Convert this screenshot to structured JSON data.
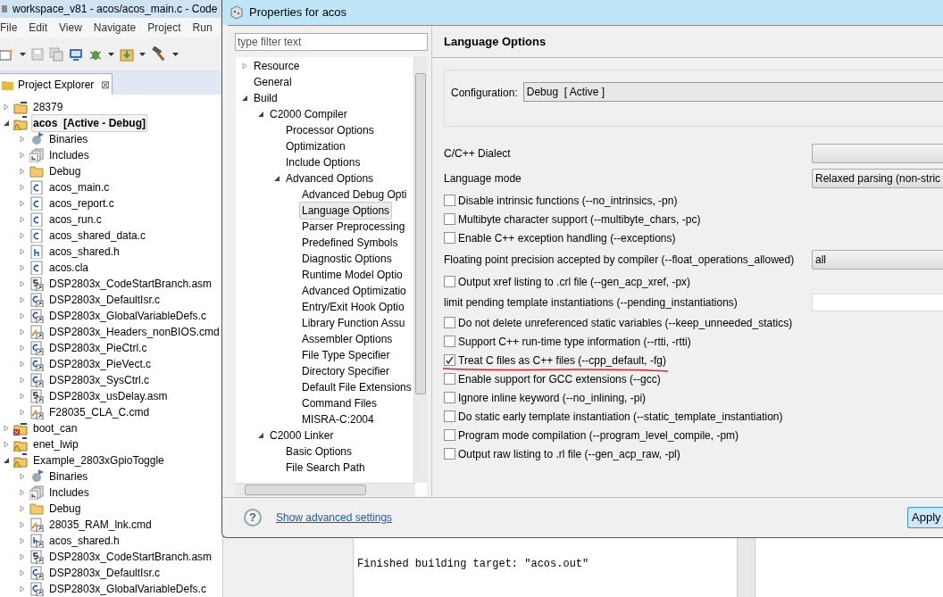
{
  "ide": {
    "title": "workspace_v81 - acos/acos_main.c - Code",
    "menu": [
      "File",
      "Edit",
      "View",
      "Navigate",
      "Project",
      "Run"
    ],
    "explorer": {
      "tab": "Project Explorer",
      "close": "⊠",
      "projects": [
        {
          "label": "28379",
          "kind": "project",
          "selected": false,
          "bold": false,
          "expanded": false
        },
        {
          "label": "acos  [Active - Debug]",
          "kind": "project-warning",
          "selected": true,
          "bold": true,
          "expanded": true,
          "children": [
            {
              "label": "Binaries",
              "kind": "binaries"
            },
            {
              "label": "Includes",
              "kind": "includes"
            },
            {
              "label": "Debug",
              "kind": "folder"
            },
            {
              "label": "acos_main.c",
              "kind": "c-file"
            },
            {
              "label": "acos_report.c",
              "kind": "c-file"
            },
            {
              "label": "acos_run.c",
              "kind": "c-file"
            },
            {
              "label": "acos_shared_data.c",
              "kind": "c-file"
            },
            {
              "label": "acos_shared.h",
              "kind": "h-file"
            },
            {
              "label": "acos.cla",
              "kind": "c-file"
            },
            {
              "label": "DSP2803x_CodeStartBranch.asm",
              "kind": "asm-link"
            },
            {
              "label": "DSP2803x_DefaultIsr.c",
              "kind": "c-link"
            },
            {
              "label": "DSP2803x_GlobalVariableDefs.c",
              "kind": "c-link"
            },
            {
              "label": "DSP2803x_Headers_nonBIOS.cmd",
              "kind": "cmd-link"
            },
            {
              "label": "DSP2803x_PieCtrl.c",
              "kind": "c-link"
            },
            {
              "label": "DSP2803x_PieVect.c",
              "kind": "c-link"
            },
            {
              "label": "DSP2803x_SysCtrl.c",
              "kind": "c-link"
            },
            {
              "label": "DSP2803x_usDelay.asm",
              "kind": "asm-link"
            },
            {
              "label": "F28035_CLA_C.cmd",
              "kind": "cmd-link"
            }
          ]
        },
        {
          "label": "boot_can",
          "kind": "project-error",
          "selected": false,
          "bold": false,
          "expanded": false
        },
        {
          "label": "enet_lwip",
          "kind": "project-warning",
          "selected": false,
          "bold": false,
          "expanded": false
        },
        {
          "label": "Example_2803xGpioToggle",
          "kind": "project-warning",
          "selected": false,
          "bold": false,
          "expanded": true,
          "children": [
            {
              "label": "Binaries",
              "kind": "binaries"
            },
            {
              "label": "Includes",
              "kind": "includes"
            },
            {
              "label": "Debug",
              "kind": "folder"
            },
            {
              "label": "28035_RAM_lnk.cmd",
              "kind": "cmd-link"
            },
            {
              "label": "acos_shared.h",
              "kind": "h-link"
            },
            {
              "label": "DSP2803x_CodeStartBranch.asm",
              "kind": "asm-link"
            },
            {
              "label": "DSP2803x_DefaultIsr.c",
              "kind": "c-link"
            },
            {
              "label": "DSP2803x_GlobalVariableDefs.c",
              "kind": "c-link"
            }
          ]
        }
      ]
    },
    "console": {
      "line": "Finished building target: \"acos.out\""
    }
  },
  "dialog": {
    "title": "Properties for acos",
    "filter": {
      "placeholder": "type filter text"
    },
    "tree": [
      {
        "label": "Resource",
        "selected": false,
        "expanded": false
      },
      {
        "label": "General",
        "selected": false
      },
      {
        "label": "Build",
        "selected": false,
        "expanded": true,
        "children": [
          {
            "label": "C2000 Compiler",
            "selected": false,
            "expanded": true,
            "children": [
              {
                "label": "Processor Options",
                "selected": false
              },
              {
                "label": "Optimization",
                "selected": false
              },
              {
                "label": "Include Options",
                "selected": false
              },
              {
                "label": "Advanced Options",
                "selected": false,
                "expanded": true,
                "children": [
                  {
                    "label": "Advanced Debug Opti",
                    "selected": false
                  },
                  {
                    "label": "Language Options",
                    "selected": true
                  },
                  {
                    "label": "Parser Preprocessing",
                    "selected": false
                  },
                  {
                    "label": "Predefined Symbols",
                    "selected": false
                  },
                  {
                    "label": "Diagnostic Options",
                    "selected": false
                  },
                  {
                    "label": "Runtime Model Optio",
                    "selected": false
                  },
                  {
                    "label": "Advanced Optimizatio",
                    "selected": false
                  },
                  {
                    "label": "Entry/Exit Hook Optio",
                    "selected": false
                  },
                  {
                    "label": "Library Function Assu",
                    "selected": false
                  },
                  {
                    "label": "Assembler Options",
                    "selected": false
                  },
                  {
                    "label": "File Type Specifier",
                    "selected": false
                  },
                  {
                    "label": "Directory Specifier",
                    "selected": false
                  },
                  {
                    "label": "Default File Extensions",
                    "selected": false
                  },
                  {
                    "label": "Command Files",
                    "selected": false
                  },
                  {
                    "label": "MISRA-C:2004",
                    "selected": false
                  }
                ]
              }
            ]
          },
          {
            "label": "C2000 Linker",
            "selected": false,
            "expanded": true,
            "children": [
              {
                "label": "Basic Options",
                "selected": false
              },
              {
                "label": "File Search Path",
                "selected": false
              }
            ]
          }
        ]
      }
    ],
    "heading": "Language Options",
    "configuration": {
      "label": "Configuration:",
      "value": "Debug  [ Active ]"
    },
    "options": [
      {
        "kind": "combo",
        "label": "C/C++ Dialect"
      },
      {
        "kind": "combo",
        "label": "Language mode",
        "value": "Relaxed parsing (non-stric"
      },
      {
        "kind": "checkbox",
        "label": "Disable intrinsic functions (--no_intrinsics, -pn)",
        "checked": false,
        "underlined": false
      },
      {
        "kind": "checkbox",
        "label": "Multibyte character support (--multibyte_chars, -pc)",
        "checked": false,
        "underlined": false
      },
      {
        "kind": "checkbox",
        "label": "Enable C++ exception handling (--exceptions)",
        "checked": false,
        "underlined": false
      },
      {
        "kind": "combo",
        "label": "Floating point precision accepted by compiler (--float_operations_allowed)",
        "value": "all"
      },
      {
        "kind": "checkbox",
        "label": "Output xref listing to .crl file (--gen_acp_xref, -px)",
        "checked": false,
        "underlined": false
      },
      {
        "kind": "field",
        "label": "limit pending template instantiations (--pending_instantiations)"
      },
      {
        "kind": "checkbox",
        "label": "Do not delete unreferenced static variables (--keep_unneeded_statics)",
        "checked": false,
        "underlined": false
      },
      {
        "kind": "checkbox",
        "label": "Support C++ run-time type information (--rtti, -rtti)",
        "checked": false,
        "underlined": false
      },
      {
        "kind": "checkbox",
        "label": "Treat C files as C++ files (--cpp_default, -fg)",
        "checked": true,
        "underlined": true
      },
      {
        "kind": "checkbox",
        "label": "Enable support for GCC extensions (--gcc)",
        "checked": false,
        "underlined": false
      },
      {
        "kind": "checkbox",
        "label": "Ignore inline keyword (--no_inlining, -pi)",
        "checked": false,
        "underlined": false
      },
      {
        "kind": "checkbox",
        "label": "Do static early template instantiation (--static_template_instantiation)",
        "checked": false,
        "underlined": false
      },
      {
        "kind": "checkbox",
        "label": "Program mode compilation (--program_level_compile, -pm)",
        "checked": false,
        "underlined": false
      },
      {
        "kind": "checkbox",
        "label": "Output raw listing to .rl file (--gen_acp_raw, -pl)",
        "checked": false,
        "underlined": false
      }
    ],
    "help": "?",
    "link": "Show advanced settings",
    "apply": "Apply"
  }
}
